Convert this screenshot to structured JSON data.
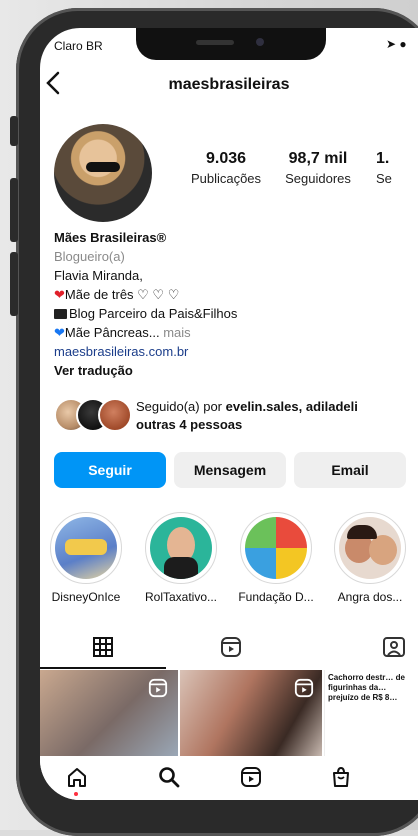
{
  "status": {
    "carrier": "Claro BR",
    "icons": "➤ ●"
  },
  "header": {
    "back_icon": "chevron-left-icon",
    "username": "maesbrasileiras"
  },
  "stats": [
    {
      "value": "9.036",
      "label": "Publicações"
    },
    {
      "value": "98,7 mil",
      "label": "Seguidores"
    },
    {
      "value": "1.",
      "label": "Se"
    }
  ],
  "bio": {
    "name": "Mães Brasileiras®",
    "category": "Blogueiro(a)",
    "line1": "Flavia Miranda,",
    "line2": "Mãe de três ♡ ♡ ♡",
    "line3": "Blog Parceiro da Pais&Filhos",
    "line4": "Mãe Pâncreas...",
    "more": "mais",
    "link": "maesbrasileiras.com.br",
    "translate": "Ver tradução"
  },
  "followed_by": {
    "prefix": "Seguido(a) por ",
    "names": "evelin.sales, adiladeli",
    "others": "outras 4 pessoas"
  },
  "actions": {
    "follow": "Seguir",
    "message": "Mensagem",
    "email": "Email"
  },
  "highlights": [
    {
      "label": "DisneyOnIce"
    },
    {
      "label": "RolTaxativo..."
    },
    {
      "label": "Fundação D..."
    },
    {
      "label": "Angra dos..."
    }
  ],
  "tabs": {
    "grid": "grid-icon",
    "reels": "reels-icon",
    "tagged": "tagged-icon"
  },
  "posts": [
    {
      "type": "reel",
      "caption": ""
    },
    {
      "type": "reel",
      "caption": ""
    },
    {
      "type": "image",
      "caption": "Cachorro destr… de figurinhas da… prejuízo de R$ 8…"
    }
  ],
  "bottom_nav": [
    "home-icon",
    "search-icon",
    "reels-icon",
    "shop-icon"
  ],
  "colors": {
    "accent": "#0095f6",
    "link": "#1b3d8a",
    "notification": "#ff3040"
  }
}
